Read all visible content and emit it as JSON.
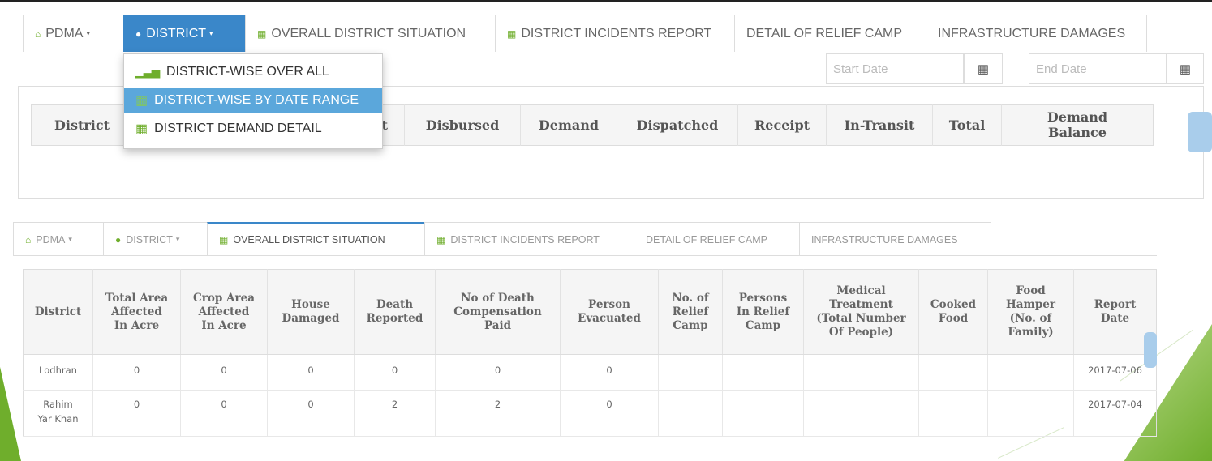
{
  "top_nav": {
    "tabs": [
      {
        "label": "PDMA",
        "icon": "home-icon",
        "caret": "▾"
      },
      {
        "label": "DISTRICT",
        "icon": "map-marker-icon",
        "caret": "▾"
      },
      {
        "label": "OVERALL DISTRICT SITUATION",
        "icon": "calendar-icon"
      },
      {
        "label": "DISTRICT INCIDENTS REPORT",
        "icon": "calendar-icon"
      },
      {
        "label": "DETAIL OF RELIEF CAMP"
      },
      {
        "label": "INFRASTRUCTURE DAMAGES"
      }
    ]
  },
  "dropdown": {
    "items": [
      {
        "label": "DISTRICT-WISE OVER ALL",
        "icon": "bar-chart-icon"
      },
      {
        "label": "DISTRICT-WISE BY DATE RANGE",
        "icon": "calendar-icon"
      },
      {
        "label": "DISTRICT DEMAND DETAIL",
        "icon": "calendar-icon"
      }
    ]
  },
  "date_filter": {
    "start_placeholder": "Start Date",
    "end_placeholder": "End Date"
  },
  "top_table": {
    "headers": [
      "District",
      "t",
      "Disbursed",
      "Demand",
      "Dispatched",
      "Receipt",
      "In-Transit",
      "Total",
      "Demand Balance"
    ]
  },
  "bottom_nav": {
    "tabs": [
      {
        "label": "PDMA",
        "caret": "▾"
      },
      {
        "label": "DISTRICT",
        "caret": "▾"
      },
      {
        "label": "OVERALL DISTRICT SITUATION"
      },
      {
        "label": "DISTRICT INCIDENTS REPORT"
      },
      {
        "label": "DETAIL OF RELIEF CAMP"
      },
      {
        "label": "INFRASTRUCTURE DAMAGES"
      }
    ]
  },
  "bottom_table": {
    "headers": [
      [
        "District"
      ],
      [
        "Total Area",
        "Affected",
        "In Acre"
      ],
      [
        "Crop Area",
        "Affected",
        "In Acre"
      ],
      [
        "House",
        "Damaged"
      ],
      [
        "Death",
        "Reported"
      ],
      [
        "No of Death",
        "Compensation",
        "Paid"
      ],
      [
        "Person",
        "Evacuated"
      ],
      [
        "No. of",
        "Relief",
        "Camp"
      ],
      [
        "Persons",
        "In Relief",
        "Camp"
      ],
      [
        "Medical",
        "Treatment",
        "(Total Number",
        "Of People)"
      ],
      [
        "Cooked",
        "Food"
      ],
      [
        "Food",
        "Hamper",
        "(No. of",
        "Family)"
      ],
      [
        "Report",
        "Date"
      ]
    ],
    "rows": [
      {
        "district": "Lodhran",
        "cells": [
          "0",
          "0",
          "0",
          "0",
          "0",
          "0",
          "",
          "",
          "",
          "",
          "",
          "2017-07-06"
        ]
      },
      {
        "district_line1": "Rahim",
        "district_line2": "Yar Khan",
        "cells": [
          "0",
          "0",
          "0",
          "2",
          "2",
          "0",
          "",
          "",
          "",
          "",
          "",
          "2017-07-04"
        ]
      }
    ]
  }
}
